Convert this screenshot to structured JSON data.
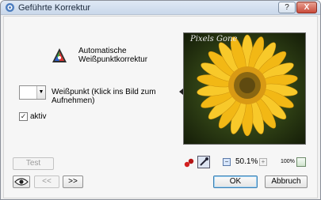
{
  "window": {
    "title": "Geführte Korrektur",
    "help_label": "?",
    "close_label": "X"
  },
  "panel": {
    "tool_label": "Automatische Weißpunktkorrektur",
    "whitepoint_label": "Weißpunkt (Klick ins Bild zum Aufnehmen)",
    "active_label": "aktiv",
    "active_checked": true,
    "dropdown_arrow": "▼"
  },
  "preview": {
    "signature": "Pixels Gone"
  },
  "toolbar": {
    "zoom_value": "50.1%",
    "zoom_100_label": "100%",
    "zoom_minus_glyph": "−",
    "zoom_plus_glyph": "+"
  },
  "buttons": {
    "test": "Test",
    "prev": "<<",
    "next": ">>",
    "ok": "OK",
    "cancel": "Abbruch",
    "eye_icon": "eye-icon"
  },
  "colors": {
    "title_bar": "#c9d8ea",
    "close_button": "#c94a3a",
    "flower_petal": "#f2b815",
    "flower_center": "#7a5a12"
  }
}
